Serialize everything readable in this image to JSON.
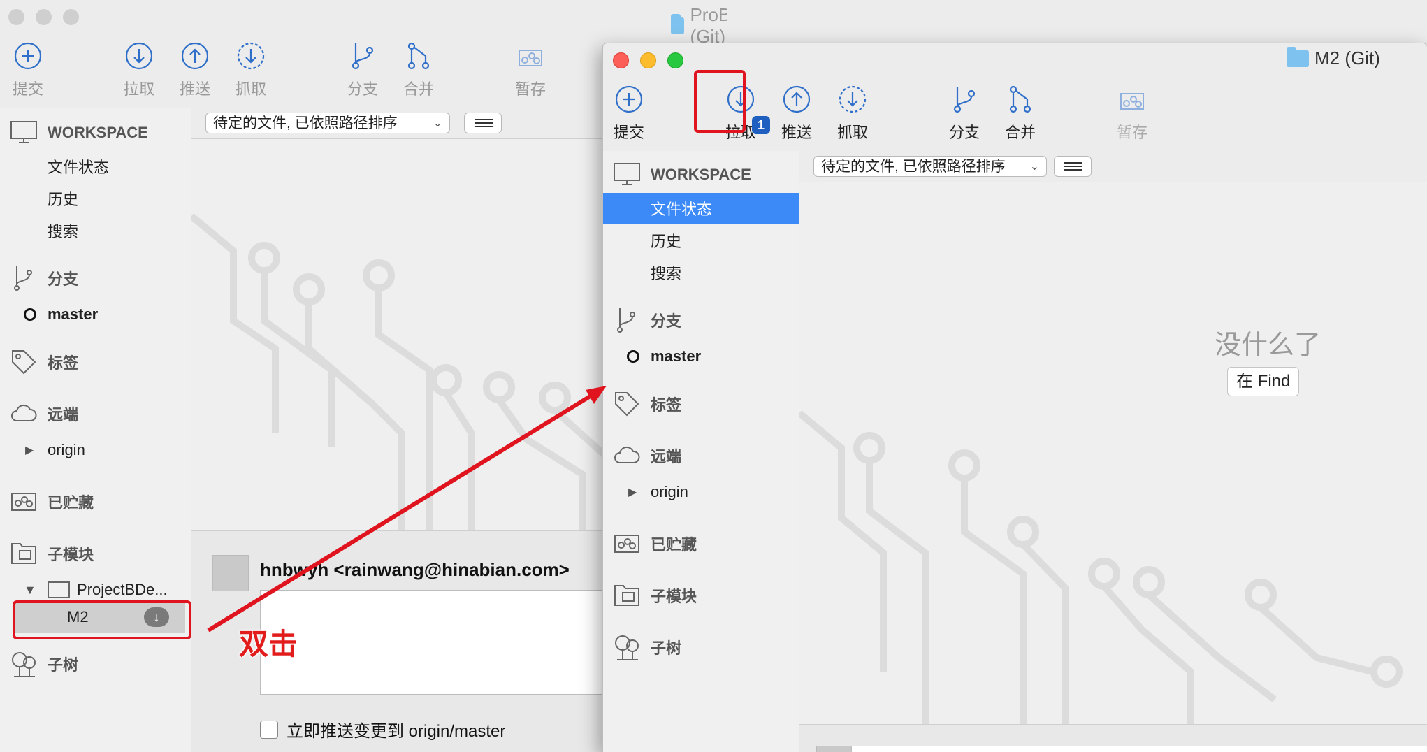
{
  "windowA": {
    "title": "ProB (Git)",
    "toolbar": {
      "commit": "提交",
      "pull": "拉取",
      "push": "推送",
      "fetch": "抓取",
      "branch": "分支",
      "merge": "合并",
      "stash": "暂存"
    },
    "filter": {
      "selected": "待定的文件, 已依照路径排序"
    },
    "sidebar": {
      "workspace": "WORKSPACE",
      "file_status": "文件状态",
      "history": "历史",
      "search": "搜索",
      "branches": "分支",
      "master": "master",
      "tags": "标签",
      "remotes": "远端",
      "origin": "origin",
      "stashes": "已贮藏",
      "submodules": "子模块",
      "project": "ProjectBDe...",
      "m2": "M2",
      "subtrees": "子树"
    },
    "commit": {
      "author": "hnbwyh <rainwang@hinabian.com>",
      "push_label": "立即推送变更到 origin/master"
    }
  },
  "windowB": {
    "title": "M2 (Git)",
    "toolbar": {
      "commit": "提交",
      "pull": "拉取",
      "pull_badge": "1",
      "push": "推送",
      "fetch": "抓取",
      "branch": "分支",
      "merge": "合并",
      "stash": "暂存"
    },
    "filter": {
      "selected": "待定的文件, 已依照路径排序"
    },
    "sidebar": {
      "workspace": "WORKSPACE",
      "file_status": "文件状态",
      "history": "历史",
      "search": "搜索",
      "branches": "分支",
      "master": "master",
      "tags": "标签",
      "remotes": "远端",
      "origin": "origin",
      "stashes": "已贮藏",
      "submodules": "子模块",
      "subtrees": "子树"
    },
    "empty": {
      "title": "没什么了",
      "finder_button": "在 Find"
    }
  },
  "annotation": {
    "double_click": "双击"
  },
  "colors": {
    "accent": "#3b8af7",
    "icon_blue": "#2f6fc9",
    "annotation_red": "#e0141e"
  }
}
